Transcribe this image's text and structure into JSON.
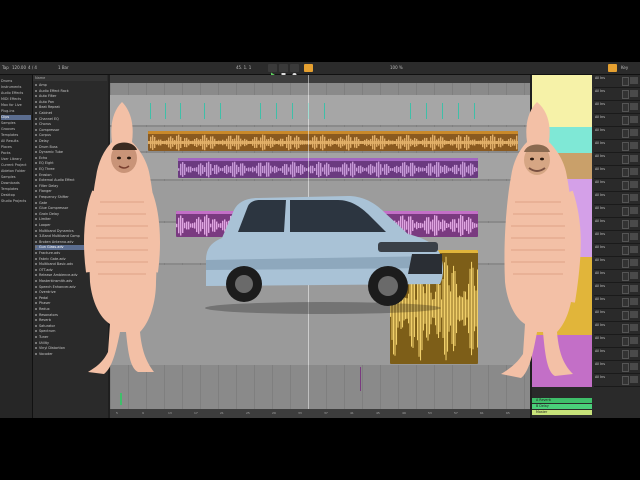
{
  "toolbar": {
    "tempo": "120.00",
    "signature": "4 / 4",
    "bar_field": "1 Bar",
    "position": "45. 1. 1",
    "zoom": "100 %",
    "end_label": "Key",
    "accent": "#e5a030"
  },
  "browser": {
    "header": "Name",
    "places": [
      "Drums",
      "Instruments",
      "Audio Effects",
      "MIDI Effects",
      "Max for Live",
      "Plug-ins",
      "Clips",
      "Samples",
      "Grooves",
      "Templates",
      "All Results",
      "Places",
      "Packs",
      "User Library",
      "Current Project",
      "Ableton Folder",
      "Samples",
      "Downloads",
      "Templates",
      "Desktop",
      "Studio Projects"
    ],
    "selected_place": 6,
    "items": [
      "Amp",
      "Audio Effect Rack",
      "Auto Filter",
      "Auto Pan",
      "Beat Repeat",
      "Cabinet",
      "Channel EQ",
      "Chorus",
      "Compressor",
      "Corpus",
      "Delay",
      "Drum Buss",
      "Dynamic Tube",
      "Echo",
      "EQ Eight",
      "EQ Three",
      "Erosion",
      "External Audio Effect",
      "Filter Delay",
      "Flanger",
      "Frequency Shifter",
      "Gate",
      "Glue Compressor",
      "Grain Delay",
      "Limiter",
      "Looper",
      "Multiband Dynamics",
      "3-Band Multiband Comp",
      "Broken Antenna.adv",
      "Gun Glass.adv",
      "Fracture.adv",
      "Fabric Gate.adv",
      "Multiband Basic.adv",
      "OTT.adv",
      "Release Ambience.adv",
      "Masterkinsmith.adv",
      "Speech Enhancer.adv",
      "Overdrive",
      "Pedal",
      "Phaser",
      "Redux",
      "Resonators",
      "Reverb",
      "Saturator",
      "Spectrum",
      "Tuner",
      "Utility",
      "Vinyl Distortion",
      "Vocoder"
    ],
    "selected_item": 29
  },
  "arrangement": {
    "bar_labels": [
      "5",
      "9",
      "13",
      "17",
      "21",
      "25",
      "29",
      "33",
      "37",
      "41",
      "45",
      "49",
      "53",
      "57",
      "61",
      "65"
    ],
    "clip_colors": {
      "teal": "#3fbfa8",
      "orange": "#c9892a",
      "purple": "#a265c0",
      "magenta": "#c36fc7",
      "yellow": "#e1b53a",
      "green": "#3fbf6a"
    }
  },
  "mixer": {
    "scene_colors": [
      "#f6f2a8",
      "#f6f2a8",
      "#7fe8d6",
      "#c9a06a",
      "#d4a0e8",
      "#d4a0e8",
      "#d4a0e8",
      "#e1b53a",
      "#e1b53a",
      "#e1b53a",
      "#c36fc7",
      "#c36fc7"
    ],
    "channel_labels": [
      "All Ins",
      "All Ins",
      "All Ins",
      "All Ins",
      "All Ins",
      "All Ins",
      "All Ins",
      "All Ins",
      "All Ins",
      "All Ins",
      "All Ins",
      "All Ins",
      "All Ins",
      "All Ins",
      "All Ins",
      "All Ins",
      "All Ins",
      "All Ins",
      "All Ins",
      "All Ins",
      "All Ins",
      "All Ins",
      "All Ins",
      "All Ins"
    ],
    "returns": [
      "A Reverb",
      "B Delay",
      "Master"
    ]
  },
  "overlay": {
    "car_color": "#a9c2d6"
  }
}
